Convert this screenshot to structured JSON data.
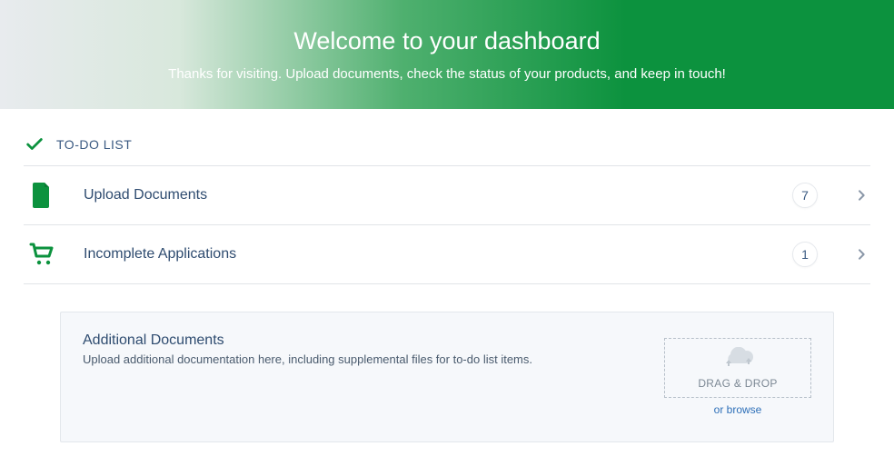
{
  "hero": {
    "title": "Welcome to your dashboard",
    "subtitle": "Thanks for visiting. Upload documents, check the status of your products, and keep in touch!"
  },
  "todo": {
    "heading": "TO-DO LIST",
    "items": [
      {
        "label": "Upload Documents",
        "count": "7"
      },
      {
        "label": "Incomplete Applications",
        "count": "1"
      }
    ]
  },
  "upload": {
    "title": "Additional Documents",
    "subtitle": "Upload additional documentation here, including supplemental files for to-do list items.",
    "drag_label": "DRAG & DROP",
    "browse_label": "or browse"
  }
}
